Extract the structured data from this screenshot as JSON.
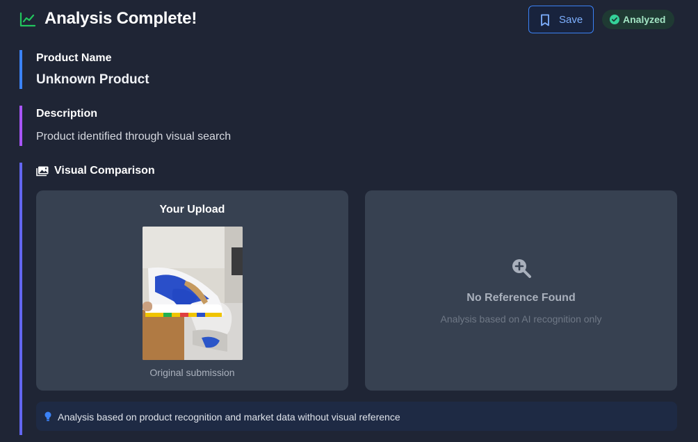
{
  "header": {
    "title": "Analysis Complete!",
    "title_icon": "trending-up-icon",
    "save_label": "Save",
    "status_label": "Analyzed"
  },
  "product_name": {
    "label": "Product Name",
    "value": "Unknown Product"
  },
  "description": {
    "label": "Description",
    "value": "Product identified through visual search"
  },
  "visual_comparison": {
    "label": "Visual Comparison",
    "icon": "image-gallery-icon",
    "upload": {
      "title": "Your Upload",
      "caption": "Original submission"
    },
    "reference": {
      "icon": "zoom-in-icon",
      "title": "No Reference Found",
      "subtitle": "Analysis based on AI recognition only"
    },
    "note": {
      "icon": "lightbulb-icon",
      "text": "Analysis based on product recognition and market data without visual reference"
    }
  },
  "colors": {
    "background": "#1f2535",
    "card": "#374151",
    "accent_blue": "#3b82f6",
    "accent_purple": "#a855f7",
    "accent_indigo": "#6366f1",
    "success": "#22c55e"
  }
}
